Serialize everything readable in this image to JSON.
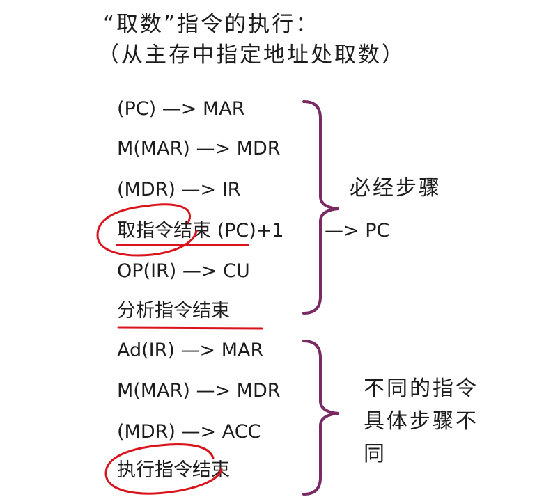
{
  "title": {
    "line1": "“取数”指令的执行：",
    "line2": "（从主存中指定地址处取数）"
  },
  "steps": [
    "(PC) —> MAR",
    "M(MAR) —> MDR",
    "(MDR) —> IR",
    "取指令结束 (PC)+1",
    "OP(IR) —> CU",
    "分析指令结束",
    "Ad(IR) —> MAR",
    "M(MAR) —> MDR",
    "(MDR) —> ACC",
    "执行指令结束"
  ],
  "pc_tail": "—> PC",
  "labels": {
    "required": "必经步骤",
    "varies": "不同的指令具体步骤不同"
  },
  "colors": {
    "text": "#1c1c1c",
    "brace": "#7a2a63",
    "annotation": "#d8141c"
  }
}
